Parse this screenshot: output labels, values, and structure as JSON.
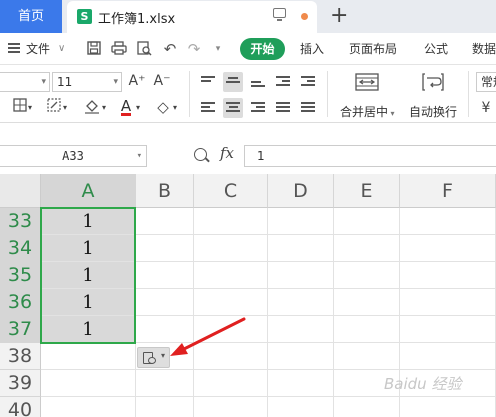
{
  "tabs": {
    "home": "首页",
    "file": "工作簿1.xlsx",
    "file_icon": "S",
    "new_tab": "+"
  },
  "menu": {
    "file": "文件",
    "file_arrow": "∨",
    "start": "开始",
    "insert": "插入",
    "page_layout": "页面布局",
    "formula": "公式",
    "data": "数据"
  },
  "ribbon": {
    "font_size": "11",
    "merge_center": "合并居中",
    "wrap_text": "自动换行",
    "number_format": "常规",
    "currency_symbol": "¥",
    "font_grow": "A⁺",
    "font_shrink": "A⁻",
    "font_color_glyph": "A"
  },
  "formula_bar": {
    "name_box": "A33",
    "fx_label": "fx",
    "formula_value": "1"
  },
  "sheet": {
    "columns": [
      "A",
      "B",
      "C",
      "D",
      "E",
      "F"
    ],
    "selected_column": "A",
    "rows": [
      "33",
      "34",
      "35",
      "36",
      "37",
      "38",
      "39",
      "40"
    ],
    "selected_rows": [
      "33",
      "34",
      "35",
      "36",
      "37"
    ],
    "a_values": [
      "1",
      "1",
      "1",
      "1",
      "1"
    ]
  },
  "colors": {
    "accent_green": "#2ea84a",
    "start_tab_green": "#1f9e5a",
    "home_tab_blue": "#3b79ea",
    "arrow_red": "#e02020"
  },
  "watermark": "Baidu 经验"
}
